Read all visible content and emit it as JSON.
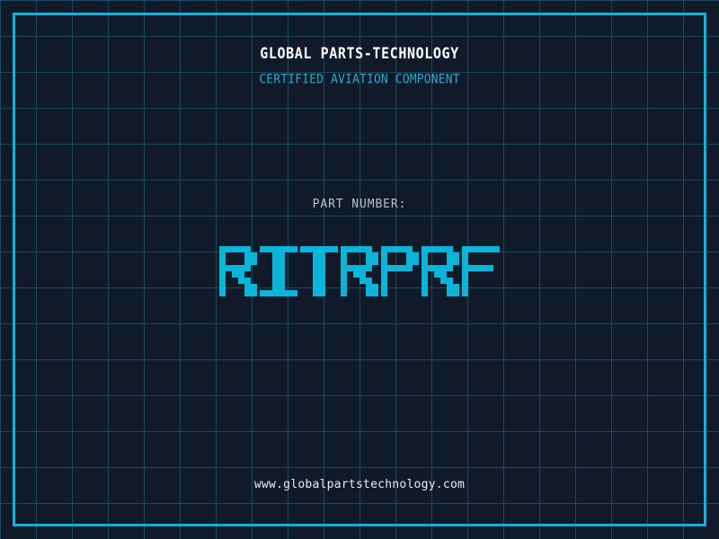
{
  "page": {
    "header": {
      "title": "GLOBAL PARTS-TECHNOLOGY",
      "subtitle": "CERTIFIED AVIATION COMPONENT"
    },
    "part": {
      "label": "PART NUMBER:",
      "number": "RITRPRF"
    },
    "footer": {
      "url": "www.globalpartstechnology.com"
    }
  },
  "colors": {
    "background": "#101a29",
    "grid_line": "#1b4a61",
    "frame": "#0cb4da",
    "title": "#ffffff",
    "subtitle": "#31a8cc",
    "part_label": "#b7c3ca",
    "part_number": "#0ab5d9",
    "url": "#e8eef0"
  }
}
